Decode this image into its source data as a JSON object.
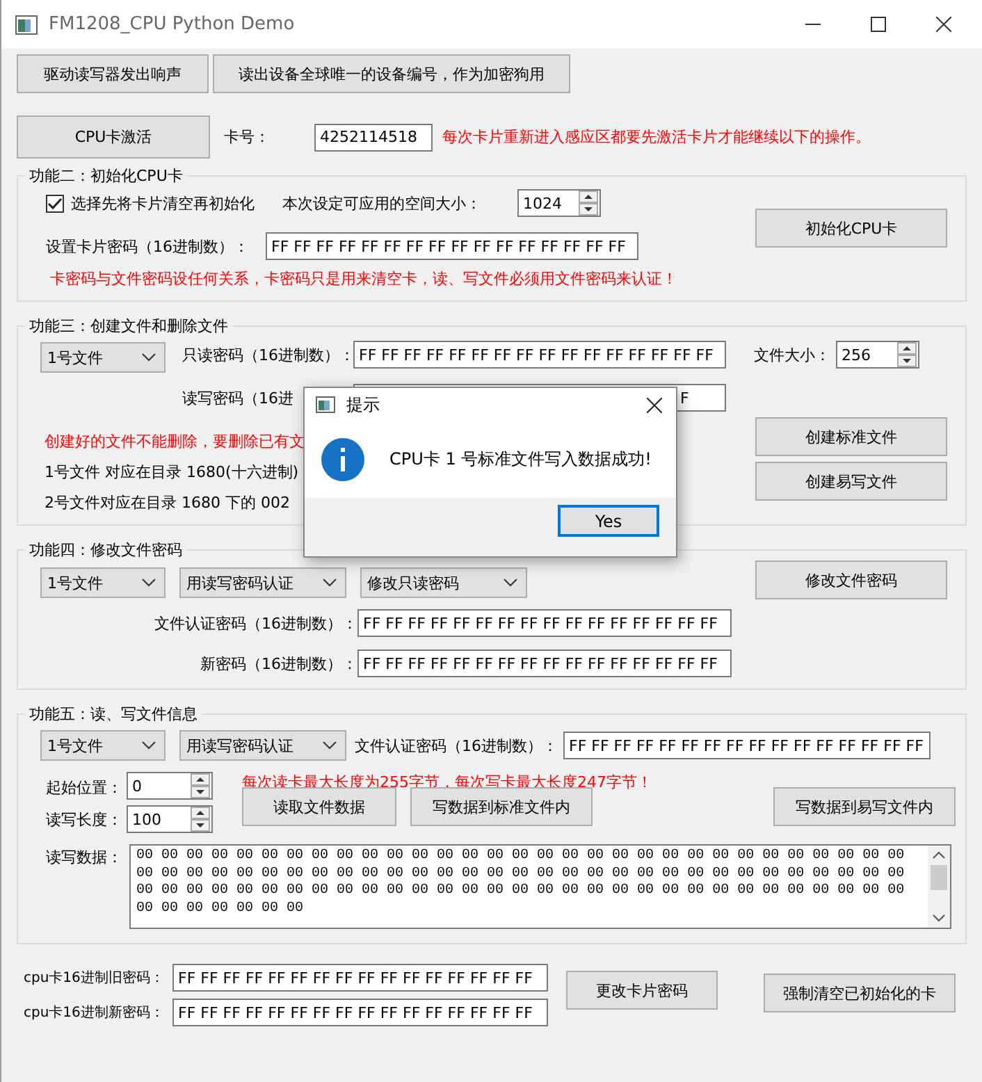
{
  "window": {
    "title": "FM1208_CPU Python Demo"
  },
  "top_buttons": [
    "驱动读写器发出响声",
    "读出设备全球唯一的设备编号，作为加密狗用"
  ],
  "activate": {
    "button": "CPU卡激活",
    "card_label": "卡号：",
    "card_number": "4252114518",
    "notice": "每次卡片重新进入感应区都要先激活卡片才能继续以下的操作。"
  },
  "init_group": {
    "title": "功能二：初始化CPU卡",
    "clear_first": {
      "label": "选择先将卡片清空再初始化",
      "checked": true
    },
    "space_label": "本次设定可应用的空间大小：",
    "space_value": "1024",
    "password_label": "设置卡片密码（16进制数）：",
    "password": "FF FF FF FF FF FF FF FF FF FF FF FF FF FF FF FF",
    "button": "初始化CPU卡",
    "warning": "卡密码与文件密码设任何关系，卡密码只是用来清空卡，读、写文件必须用文件密码来认证！"
  },
  "create_group": {
    "title": "功能三：创建文件和删除文件",
    "file_select": "1号文件",
    "readonly_label": "只读密码（16进制数）：",
    "readonly_password": "FF FF FF FF FF FF FF FF FF FF FF FF FF FF FF FF",
    "size_label": "文件大小：",
    "size_value": "256",
    "readwrite_label": "读写密码（16进",
    "readwrite_password": "F",
    "warning": "创建好的文件不能删除，要删除已有文",
    "note_1": "1号文件  对应在目录  1680(十六进制)",
    "note_2": "2号文件对应在目录  1680  下的  002",
    "buttons": [
      "创建标准文件",
      "创建易写文件"
    ]
  },
  "modify_group": {
    "title": "功能四：修改文件密码",
    "selects": [
      "1号文件",
      "用读写密码认证",
      "修改只读密码"
    ],
    "button": "修改文件密码",
    "auth_label": "文件认证密码（16进制数）：",
    "auth_password": "FF FF FF FF FF FF FF FF FF FF FF FF FF FF FF FF",
    "new_label": "新密码（16进制数）：",
    "new_password": "FF FF FF FF FF FF FF FF FF FF FF FF FF FF FF FF"
  },
  "rw_group": {
    "title": "功能五：读、写文件信息",
    "selects": [
      "1号文件",
      "用读写密码认证"
    ],
    "auth_label": "文件认证密码（16进制数）：",
    "auth_password": "FF FF FF FF FF FF FF FF FF FF FF FF FF FF FF FF",
    "start_label": "起始位置：",
    "start_value": "0",
    "notice": "每次读卡最大长度为255字节，每次写卡最大长度247字节！",
    "length_label": "读写长度：",
    "length_value": "100",
    "buttons": [
      "读取文件数据",
      "写数据到标准文件内",
      "写数据到易写文件内"
    ],
    "data_label": "读写数据：",
    "data": "00 00 00 00 00 00 00 00 00 00 00 00 00 00 00 00 00 00 00 00 00 00 00 00 00 00 00 00 00 00 00 00 00 00 00 00 00 00 00 00 00 00 00 00 00 00 00 00 00 00 00 00 00 00 00 00 00 00 00 00 00 00 00 00 00 00 00 00 00 00 00 00 00 00 00 00 00 00 00 00 00 00 00 00 00 00 00 00 00 00 00 00 00 00 00 00 00 00 00 00"
  },
  "card_password": {
    "old_label": "cpu卡16进制旧密码：",
    "old_password": "FF FF FF FF FF FF FF FF FF FF FF FF FF FF FF FF",
    "new_label": "cpu卡16进制新密码：",
    "new_password": "FF FF FF FF FF FF FF FF FF FF FF FF FF FF FF FF",
    "buttons": [
      "更改卡片密码",
      "强制清空已初始化的卡"
    ]
  },
  "dialog": {
    "title": "提示",
    "message": "CPU卡 1 号标准文件写入数据成功!",
    "button": "Yes"
  }
}
